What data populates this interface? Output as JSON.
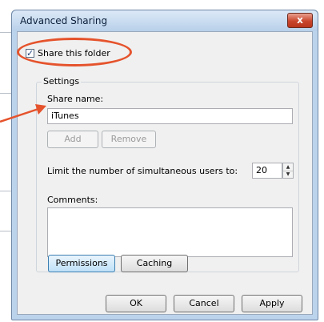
{
  "dialog": {
    "title": "Advanced Sharing",
    "close_glyph": "x"
  },
  "share": {
    "checkbox_label": "Share this folder",
    "checked": true,
    "check_glyph": "✓"
  },
  "settings": {
    "group_label": "Settings",
    "share_name_label": "Share name:",
    "share_name_value": "iTunes",
    "add_label": "Add",
    "remove_label": "Remove",
    "limit_label": "Limit the number of simultaneous users to:",
    "limit_value": "20",
    "comments_label": "Comments:",
    "comments_value": "",
    "permissions_label": "Permissions",
    "caching_label": "Caching"
  },
  "footer": {
    "ok_label": "OK",
    "cancel_label": "Cancel",
    "apply_label": "Apply"
  },
  "annotation": {
    "color": "#e5532c"
  }
}
